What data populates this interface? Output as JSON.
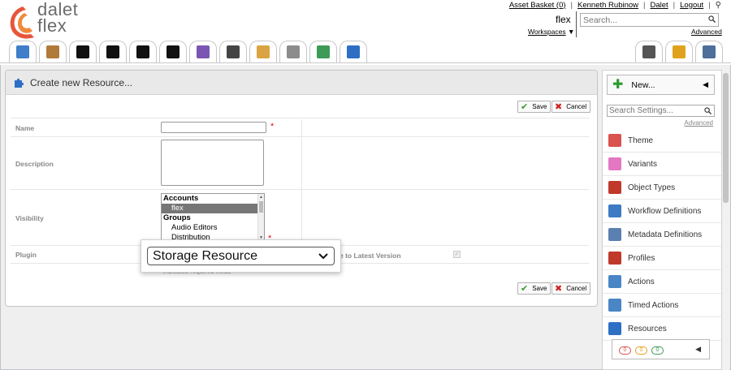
{
  "app": {
    "name": "dalet flex",
    "logo_line1": "dalet",
    "logo_line2": "flex"
  },
  "top_links": {
    "asset_basket": "Asset Basket (0)",
    "user": "Kenneth Rubinow",
    "dalet": "Dalet",
    "logout": "Logout"
  },
  "workspace": {
    "name": "flex",
    "workspaces_label": "Workspaces"
  },
  "search": {
    "placeholder": "Search...",
    "advanced": "Advanced"
  },
  "tabs": [
    {
      "icon": "window-icon",
      "color": "#3f7ec9"
    },
    {
      "icon": "box-icon",
      "color": "#b07a3a"
    },
    {
      "icon": "glasses-icon",
      "color": "#111111"
    },
    {
      "icon": "glasses-icon",
      "color": "#111111"
    },
    {
      "icon": "glasses-icon",
      "color": "#111111"
    },
    {
      "icon": "glasses-icon",
      "color": "#111111"
    },
    {
      "icon": "t-icon",
      "color": "#7a56b2"
    },
    {
      "icon": "clapper-icon",
      "color": "#444444"
    },
    {
      "icon": "clipboard-icon",
      "color": "#d9a441"
    },
    {
      "icon": "gear-icon",
      "color": "#8c8c8c"
    },
    {
      "icon": "workflow-icon",
      "color": "#3d9a57"
    },
    {
      "icon": "puzzle-icon",
      "color": "#2d6fc4"
    }
  ],
  "tabs_right": [
    {
      "icon": "sliders-icon",
      "color": "#555555"
    },
    {
      "icon": "lock-icon",
      "color": "#e0a21c"
    },
    {
      "icon": "tools-icon",
      "color": "#4d6f9a"
    }
  ],
  "panel": {
    "title": "Create new Resource...",
    "save_label": "Save",
    "cancel_label": "Cancel",
    "fields": {
      "name_label": "Name",
      "description_label": "Description",
      "visibility_label": "Visibility",
      "plugin_label": "Plugin"
    },
    "visibility_options": [
      {
        "label": "Accounts",
        "group": true,
        "selected": false
      },
      {
        "label": "flex",
        "group": false,
        "selected": true
      },
      {
        "label": "Groups",
        "group": true,
        "selected": false
      },
      {
        "label": "Audio Editors",
        "group": false,
        "selected": false
      },
      {
        "label": "Distribution",
        "group": false,
        "selected": false
      }
    ],
    "latest_version_label": "e to Latest Version",
    "required_note": "* indicates required fields",
    "plugin_value": "Storage Resource"
  },
  "sidebar": {
    "new_label": "New...",
    "search_placeholder": "Search Settings...",
    "advanced": "Advanced",
    "items": [
      {
        "label": "Theme",
        "icon": "theme-icon",
        "color": "#d9534f"
      },
      {
        "label": "Variants",
        "icon": "variants-icon",
        "color": "#e377c2"
      },
      {
        "label": "Object Types",
        "icon": "object-types-icon",
        "color": "#c0392b"
      },
      {
        "label": "Workflow Definitions",
        "icon": "workflow-icon",
        "color": "#3d7ac4"
      },
      {
        "label": "Metadata Definitions",
        "icon": "metadata-icon",
        "color": "#5b7fb0"
      },
      {
        "label": "Profiles",
        "icon": "profiles-icon",
        "color": "#c0392b"
      },
      {
        "label": "Actions",
        "icon": "gear-icon",
        "color": "#4a86c5"
      },
      {
        "label": "Timed Actions",
        "icon": "gear-clock-icon",
        "color": "#4a86c5"
      },
      {
        "label": "Resources",
        "icon": "puzzle-icon",
        "color": "#2d6fc4"
      }
    ],
    "status_counts": [
      "0",
      "0",
      "0"
    ],
    "status_colors": [
      "#d9534f",
      "#e0a21c",
      "#3d9a57"
    ]
  }
}
